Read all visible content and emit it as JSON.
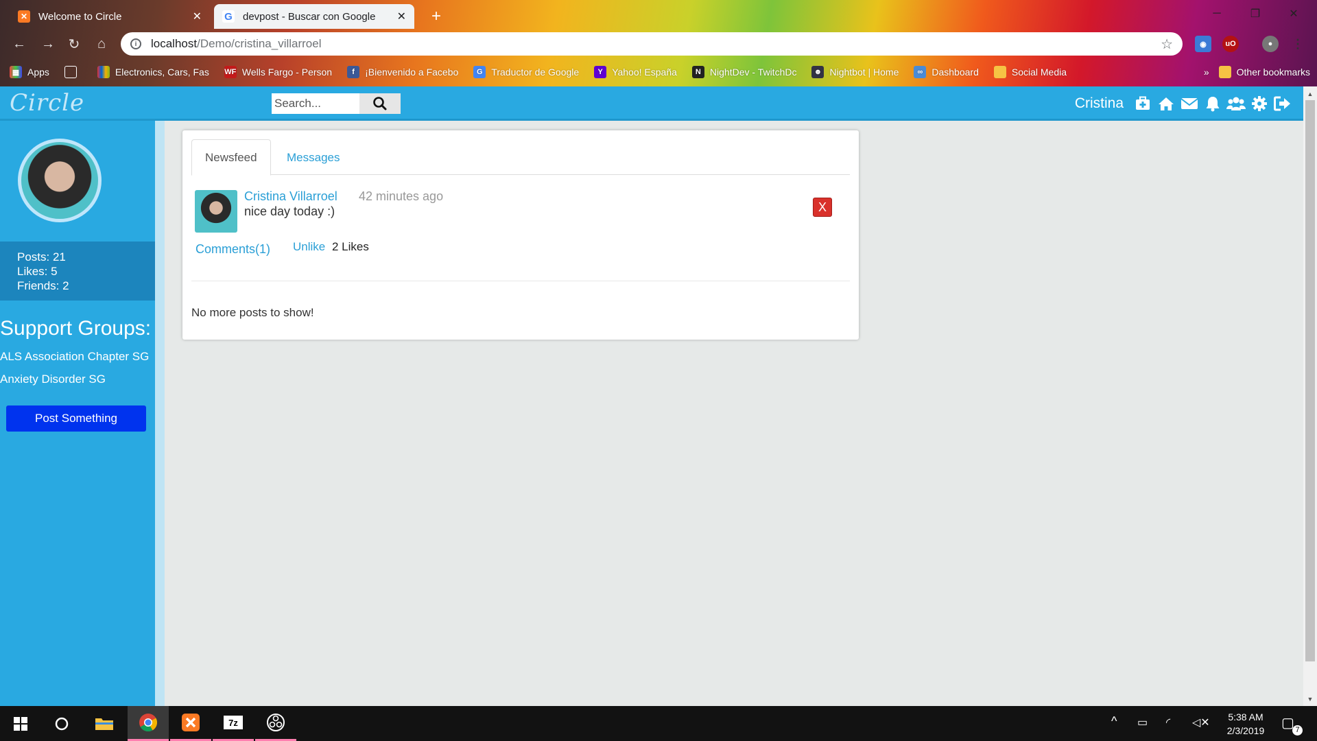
{
  "browser": {
    "tabs": [
      {
        "title": "Welcome to Circle",
        "active": false
      },
      {
        "title": "devpost - Buscar con Google",
        "active": true
      }
    ],
    "url_host": "localhost",
    "url_path": "/Demo/cristina_villarroel",
    "bookmarks": [
      {
        "label": "Apps",
        "icon": "apps-grid-icon"
      },
      {
        "label": "",
        "icon": "document-icon"
      },
      {
        "label": "Electronics, Cars, Fas",
        "icon": "ebay-icon"
      },
      {
        "label": "Wells Fargo - Person",
        "icon": "wells-fargo-icon"
      },
      {
        "label": "¡Bienvenido a Facebo",
        "icon": "facebook-icon"
      },
      {
        "label": "Traductor de Google",
        "icon": "translate-icon"
      },
      {
        "label": "Yahoo! España",
        "icon": "yahoo-icon"
      },
      {
        "label": "NightDev - TwitchDc",
        "icon": "nightdev-icon"
      },
      {
        "label": "Nightbot | Home",
        "icon": "nightbot-icon"
      },
      {
        "label": "Dashboard",
        "icon": "dashboard-icon"
      },
      {
        "label": "Social Media",
        "icon": "folder-icon"
      }
    ],
    "overflow": "»",
    "other_bookmarks": "Other bookmarks"
  },
  "header": {
    "logo": "Circle",
    "search_placeholder": "Search...",
    "username": "Cristina",
    "icons": [
      "medkit-icon",
      "home-icon",
      "envelope-icon",
      "bell-icon",
      "users-icon",
      "gear-icon",
      "logout-icon"
    ]
  },
  "sidebar": {
    "stats": {
      "posts": "Posts: 21",
      "likes": "Likes: 5",
      "friends": "Friends: 2"
    },
    "groups_heading": "Support Groups:",
    "groups": [
      "ALS Association Chapter SG",
      "Anxiety Disorder SG"
    ],
    "post_button": "Post Something"
  },
  "main": {
    "tabs": [
      "Newsfeed",
      "Messages"
    ],
    "post": {
      "author": "Cristina Villarroel",
      "time": "42 minutes ago",
      "body": "nice day today :)",
      "delete_label": "X",
      "comments_label": "Comments(1)",
      "unlike_label": "Unlike",
      "likes_label": "2 Likes"
    },
    "end_message": "No more posts to show!"
  },
  "taskbar": {
    "clock_time": "5:38 AM",
    "clock_date": "2/3/2019",
    "notifications": "7"
  },
  "colors": {
    "brand": "#29a9e1",
    "link": "#2a9fd6",
    "post_button": "#0033ee",
    "delete": "#d9312b"
  }
}
